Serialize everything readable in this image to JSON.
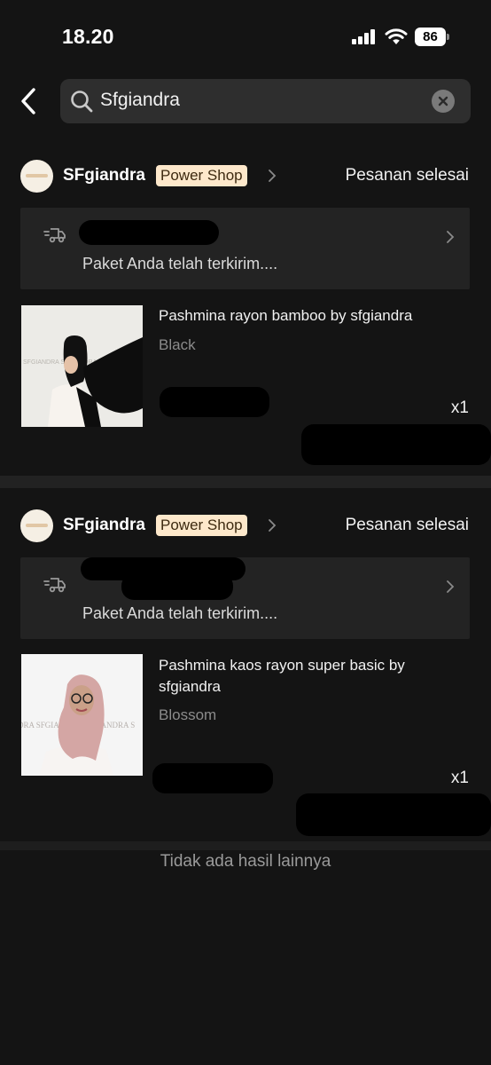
{
  "status_bar": {
    "time": "18.20",
    "battery": "86"
  },
  "search": {
    "query": "Sfgiandra"
  },
  "orders": [
    {
      "shop_name": "SFgiandra",
      "badge": "Power Shop",
      "status": "Pesanan selesai",
      "delivery_message": "Paket Anda telah terkirim....",
      "product_name": "Pashmina rayon bamboo by sfgiandra",
      "variant": "Black",
      "quantity": "x1"
    },
    {
      "shop_name": "SFgiandra",
      "badge": "Power Shop",
      "status": "Pesanan selesai",
      "delivery_message": "Paket Anda telah terkirim....",
      "product_name": "Pashmina kaos rayon super basic by sfgiandra",
      "variant": "Blossom",
      "quantity": "x1"
    }
  ],
  "footer": {
    "no_more_results": "Tidak ada hasil lainnya"
  },
  "colors": {
    "background": "#141414",
    "card": "#232323",
    "badge_bg": "#fde8cb",
    "search_bg": "#2e2e2e"
  }
}
